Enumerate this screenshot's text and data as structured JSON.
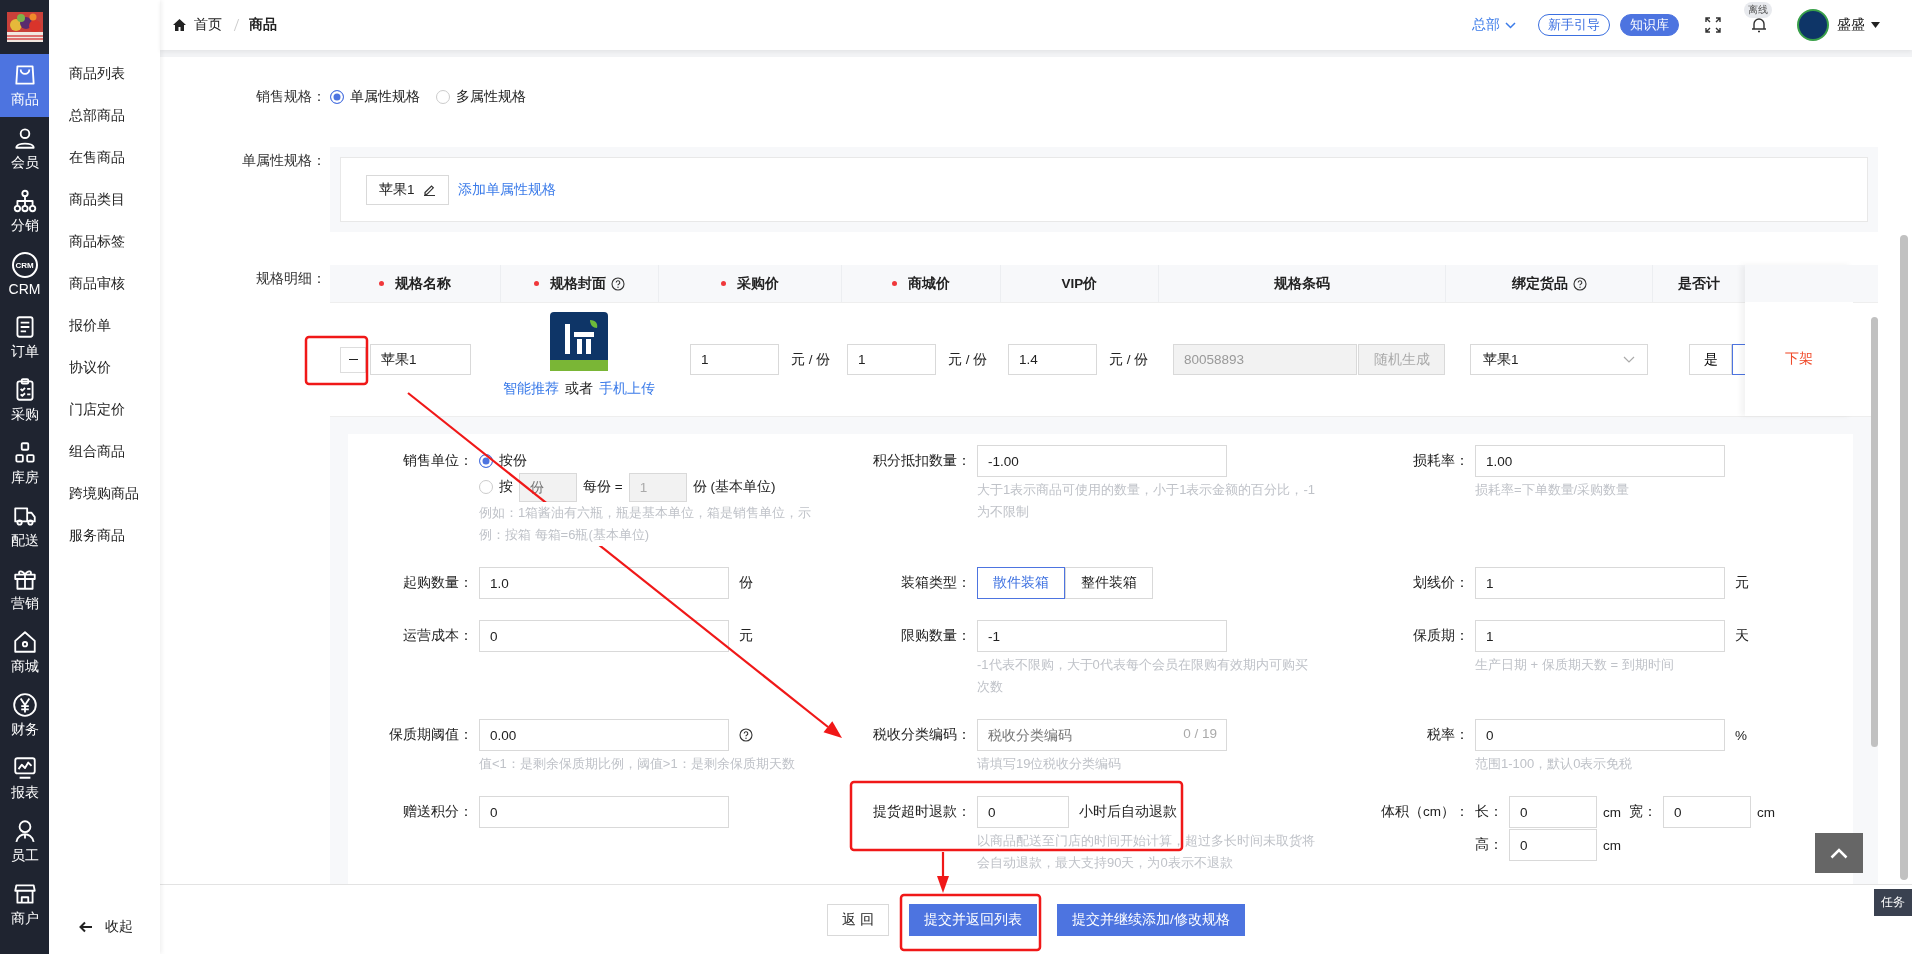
{
  "nav_rail": [
    {
      "label": "商品",
      "selected": true
    },
    {
      "label": "会员",
      "selected": false
    },
    {
      "label": "分销",
      "selected": false
    },
    {
      "label": "CRM",
      "badge": "CRM",
      "selected": false
    },
    {
      "label": "订单",
      "selected": false
    },
    {
      "label": "采购",
      "selected": false
    },
    {
      "label": "库房",
      "selected": false
    },
    {
      "label": "配送",
      "selected": false
    },
    {
      "label": "营销",
      "selected": false
    },
    {
      "label": "商城",
      "selected": false
    },
    {
      "label": "财务",
      "selected": false
    },
    {
      "label": "报表",
      "selected": false
    },
    {
      "label": "员工",
      "selected": false
    },
    {
      "label": "商户",
      "selected": false
    }
  ],
  "submenu": {
    "items": [
      "商品列表",
      "总部商品",
      "在售商品",
      "商品类目",
      "商品标签",
      "商品审核",
      "报价单",
      "协议价",
      "门店定价",
      "组合商品",
      "跨境购商品",
      "服务商品"
    ],
    "collapse": "收起"
  },
  "breadcrumb": [
    "首页",
    "商品"
  ],
  "header": {
    "org": "总部",
    "guide_button": "新手引导",
    "kb_button": "知识库",
    "status_badge": "离线",
    "user": "盛盛"
  },
  "sale_spec": {
    "label": "销售规格：",
    "options": [
      {
        "label": "单属性规格",
        "selected": true
      },
      {
        "label": "多属性规格",
        "selected": false
      }
    ]
  },
  "single_spec": {
    "label": "单属性规格：",
    "tags": [
      "苹果1"
    ],
    "add_link": "添加单属性规格"
  },
  "spec_detail": {
    "label": "规格明细：",
    "columns": [
      {
        "label": "规格名称",
        "required": true,
        "help": false
      },
      {
        "label": "规格封面",
        "required": true,
        "help": true
      },
      {
        "label": "采购价",
        "required": true,
        "help": false
      },
      {
        "label": "商城价",
        "required": true,
        "help": false
      },
      {
        "label": "VIP价",
        "required": false,
        "help": false
      },
      {
        "label": "规格条码",
        "required": false,
        "help": false
      },
      {
        "label": "绑定货品",
        "required": false,
        "help": true
      },
      {
        "label": "是否计",
        "required": false,
        "help": false
      }
    ],
    "row": {
      "name": "苹果1",
      "recommend_link": "智能推荐",
      "or": "或者",
      "upload_link": "手机上传",
      "prices": [
        {
          "value": "1",
          "unit": "元 / 份"
        },
        {
          "value": "1",
          "unit": "元 / 份"
        },
        {
          "value": "1.4",
          "unit": "元 / 份"
        }
      ],
      "barcode": "80058893",
      "random_button": "随机生成",
      "bound_goods": "苹果1",
      "weigh": "是",
      "action": "下架"
    }
  },
  "fields": [
    {
      "kind": "unit_choice",
      "label": "销售单位：",
      "options": [
        {
          "label": "按份",
          "selected": true
        },
        {
          "label": "按",
          "selected": false,
          "unit_placeholder": "份",
          "each": "每份 =",
          "qty": "1",
          "suffix": "份 (基本单位)"
        }
      ],
      "hint": "例如：1箱酱油有六瓶，瓶是基本单位，箱是销售单位，示例：按箱 每箱=6瓶(基本单位)"
    },
    {
      "kind": "input",
      "label": "积分抵扣数量：",
      "value": "-1.00",
      "hint": "大于1表示商品可使用的数量，小于1表示金额的百分比，-1为不限制"
    },
    {
      "kind": "input",
      "label": "损耗率：",
      "value": "1.00",
      "hint": "损耗率=下单数量/采购数量"
    },
    {
      "kind": "input",
      "label": "起购数量：",
      "value": "1.0",
      "unit": "份"
    },
    {
      "kind": "toggle",
      "label": "装箱类型：",
      "options": [
        {
          "label": "散件装箱",
          "selected": true
        },
        {
          "label": "整件装箱",
          "selected": false
        }
      ]
    },
    {
      "kind": "input",
      "label": "划线价：",
      "value": "1",
      "unit": "元"
    },
    {
      "kind": "input",
      "label": "运营成本：",
      "value": "0",
      "unit": "元"
    },
    {
      "kind": "input",
      "label": "限购数量：",
      "value": "-1",
      "hint": "-1代表不限购，大于0代表每个会员在限购有效期内可购买次数"
    },
    {
      "kind": "input",
      "label": "保质期：",
      "value": "1",
      "unit": "天",
      "hint": "生产日期 + 保质期天数 = 到期时间"
    },
    {
      "kind": "input",
      "label": "保质期阈值：",
      "value": "0.00",
      "help": true,
      "hint": "值<1：是剩余保质期比例，阈值>1：是剩余保质期天数"
    },
    {
      "kind": "input",
      "label": "税收分类编码：",
      "placeholder": "税收分类编码",
      "counter": "0 / 19",
      "hint": "请填写19位税收分类编码"
    },
    {
      "kind": "input",
      "label": "税率：",
      "value": "0",
      "unit": "%",
      "hint": "范围1-100，默认0表示免税"
    },
    {
      "kind": "input",
      "label": "赠送积分：",
      "value": "0"
    },
    {
      "kind": "short_input",
      "label": "提货超时退款：",
      "value": "0",
      "unit": "小时后自动退款",
      "hint": "以商品配送至门店的时间开始计算，超过多长时间未取货将会自动退款，最大支持90天，为0表示不退款"
    },
    {
      "kind": "volume",
      "label": "体积（cm）：",
      "parts": [
        {
          "label": "长：",
          "value": "0",
          "unit": "cm"
        },
        {
          "label": "宽：",
          "value": "0",
          "unit": "cm"
        },
        {
          "label": "高：",
          "value": "0",
          "unit": "cm"
        }
      ]
    }
  ],
  "footer": {
    "back_button": "返 回",
    "submit_button": "提交并返回列表",
    "continue_button": "提交并继续添加/修改规格"
  },
  "task_tab": "任务"
}
